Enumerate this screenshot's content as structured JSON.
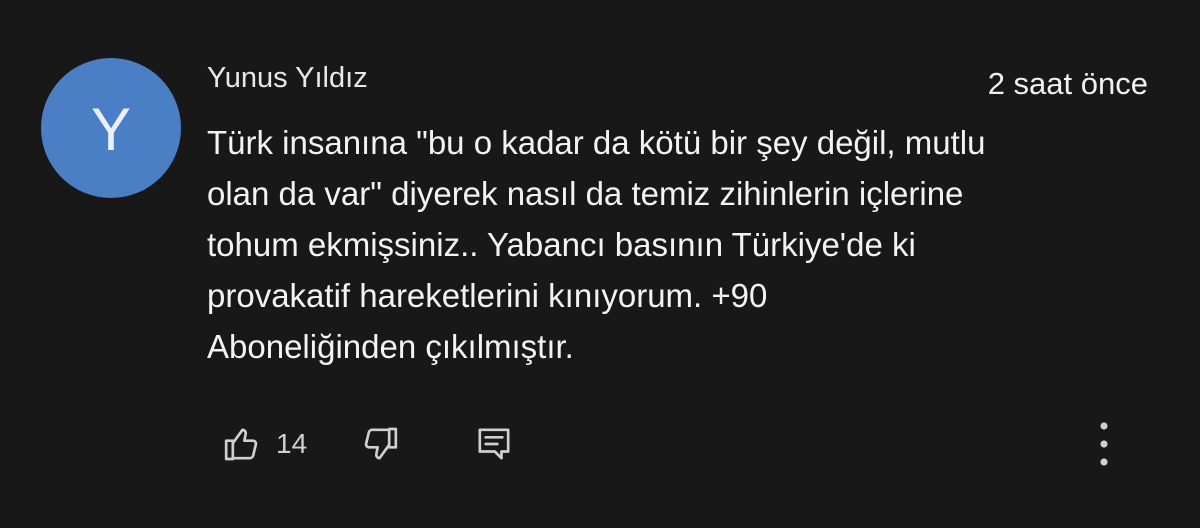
{
  "comment": {
    "author": "Yunus Yıldız",
    "avatar_letter": "Y",
    "time": "2 saat önce",
    "text": "Türk insanına \"bu o kadar da kötü bir şey değil, mutlu\nolan da var\" diyerek nasıl da temiz zihinlerin içlerine\ntohum ekmişsiniz.. Yabancı basının Türkiye'de ki\nprovakatif hareketlerini kınıyorum. +90\nAboneliğinden çıkılmıştır.",
    "like_count": "14",
    "avatar_color": "#4a7fc6",
    "icons": {
      "like": "thumbs-up-icon",
      "dislike": "thumbs-down-icon",
      "reply": "reply-comment-icon",
      "more": "more-vertical-icon"
    }
  }
}
